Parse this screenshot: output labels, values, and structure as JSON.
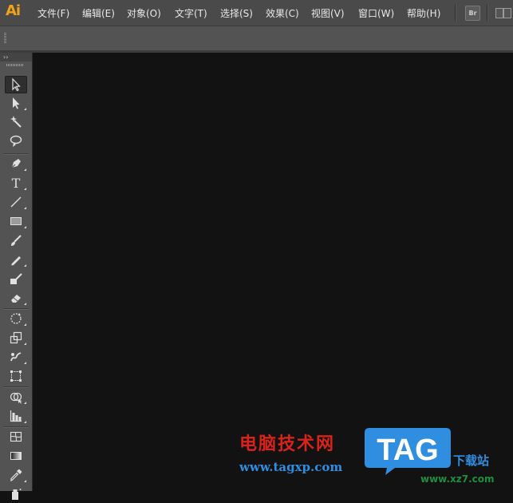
{
  "app": {
    "logo_text": "Ai",
    "logo_color": "#f0a21a"
  },
  "menu": [
    {
      "id": "file",
      "label": "文件(F)"
    },
    {
      "id": "edit",
      "label": "编辑(E)"
    },
    {
      "id": "object",
      "label": "对象(O)"
    },
    {
      "id": "type",
      "label": "文字(T)"
    },
    {
      "id": "select",
      "label": "选择(S)"
    },
    {
      "id": "effect",
      "label": "效果(C)"
    },
    {
      "id": "view",
      "label": "视图(V)"
    },
    {
      "id": "window",
      "label": "窗口(W)"
    },
    {
      "id": "help",
      "label": "帮助(H)"
    }
  ],
  "bridge_button": {
    "label": "Br",
    "icon": "bridge-icon"
  },
  "workspace_button": {
    "icon": "arrange-documents-icon"
  },
  "tool_panel": {
    "collapse_label": "››",
    "tools": [
      {
        "id": "selection",
        "icon": "selection-arrow-icon",
        "active": true
      },
      {
        "id": "direct-selection",
        "icon": "direct-selection-icon"
      },
      {
        "id": "magic-wand",
        "icon": "magic-wand-icon"
      },
      {
        "id": "lasso",
        "icon": "lasso-icon"
      },
      {
        "id": "pen",
        "icon": "pen-icon"
      },
      {
        "id": "type",
        "icon": "type-icon",
        "glyph": "T"
      },
      {
        "id": "line-segment",
        "icon": "line-segment-icon"
      },
      {
        "id": "rectangle",
        "icon": "rectangle-icon"
      },
      {
        "id": "paintbrush",
        "icon": "paintbrush-icon"
      },
      {
        "id": "pencil",
        "icon": "pencil-icon"
      },
      {
        "id": "blob-brush",
        "icon": "blob-brush-icon"
      },
      {
        "id": "eraser",
        "icon": "eraser-icon"
      },
      {
        "id": "rotate",
        "icon": "rotate-icon"
      },
      {
        "id": "scale",
        "icon": "scale-icon"
      },
      {
        "id": "warp",
        "icon": "warp-icon"
      },
      {
        "id": "free-transform",
        "icon": "free-transform-icon"
      },
      {
        "id": "shape-builder",
        "icon": "shape-builder-icon"
      },
      {
        "id": "graph",
        "icon": "column-graph-icon"
      },
      {
        "id": "mesh",
        "icon": "mesh-icon"
      },
      {
        "id": "gradient",
        "icon": "gradient-icon"
      },
      {
        "id": "eyedropper",
        "icon": "eyedropper-icon"
      },
      {
        "id": "symbol-sprayer",
        "icon": "symbol-sprayer-icon"
      }
    ]
  },
  "watermark": {
    "site_name": "电脑技术网",
    "url": "www.tagxp.com",
    "badge_text": "TAG",
    "badge_color": "#2f8ee0",
    "download_text": "下载站",
    "xz_url": "www.xz7.com"
  }
}
